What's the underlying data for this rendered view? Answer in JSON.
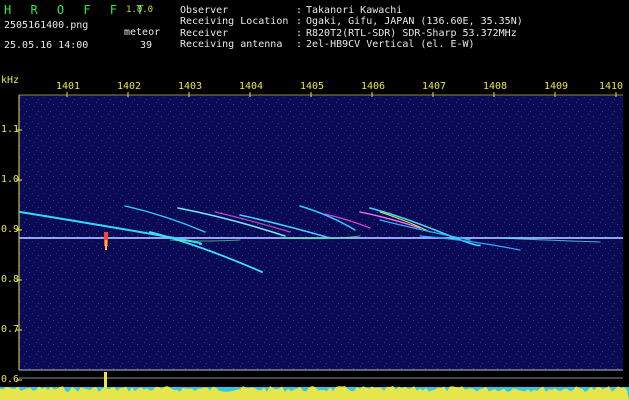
{
  "app": {
    "name": "H R O F F T",
    "version": "1.0.0"
  },
  "file": {
    "name": "2505161400.png",
    "datetime": "25.05.16 14:00"
  },
  "stats": {
    "label": "meteor",
    "count": "39"
  },
  "meta": [
    {
      "key": "Observer",
      "sep": ":",
      "value": "Takanori Kawachi"
    },
    {
      "key": "Receiving Location",
      "sep": ":",
      "value": "Ogaki, Gifu, JAPAN (136.60E, 35.35N)"
    },
    {
      "key": "Receiver",
      "sep": ":",
      "value": "R820T2(RTL-SDR) SDR-Sharp 53.372MHz"
    },
    {
      "key": "Receiving antenna",
      "sep": ":",
      "value": "2el-HB9CV Vertical (el. E-W)"
    }
  ],
  "axis": {
    "unit": "kHz",
    "time_ticks": [
      "1401",
      "1402",
      "1403",
      "1404",
      "1405",
      "1406",
      "1407",
      "1408",
      "1409",
      "1410"
    ],
    "freq_ticks": [
      "1.1",
      "1.0",
      "0.9",
      "0.8",
      "0.7",
      "0.6"
    ]
  },
  "colors": {
    "background": "#000000",
    "spectrum_bg": "#0a0a55",
    "label": "#e6e64a",
    "carrier": "#b8c8ff",
    "level_yellow": "#e6e64a",
    "level_cyan": "#30c8e8"
  }
}
